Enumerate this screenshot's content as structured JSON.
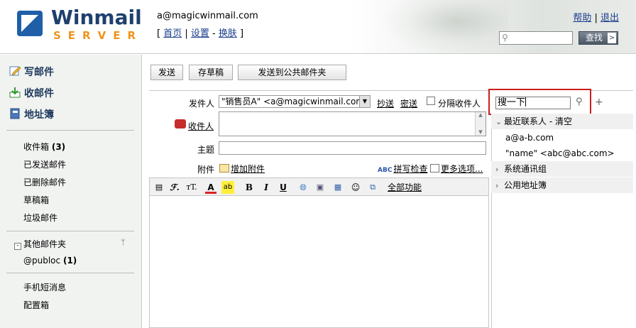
{
  "app": {
    "logo_word1": "Winmail",
    "logo_word2": "SERVER",
    "user_email": "a@magicwinmail.com",
    "top_links": [
      "首页",
      "设置",
      "换肤"
    ],
    "help": "帮助",
    "logout": "退出",
    "search_button": "查找",
    "brand_color": "#1f3f6e",
    "accent_color": "#f0941c"
  },
  "sidebar": {
    "compose": "写邮件",
    "inbox": "收邮件",
    "addressbook": "地址簿",
    "folders": [
      {
        "name": "收件箱",
        "count": "(3)"
      },
      {
        "name": "已发送邮件",
        "count": ""
      },
      {
        "name": "已删除邮件",
        "count": ""
      },
      {
        "name": "草稿箱",
        "count": ""
      },
      {
        "name": "垃圾邮件",
        "count": ""
      }
    ],
    "other_folders": "其他邮件夹",
    "public_folder": {
      "name": "@publoc",
      "count": "(1)"
    },
    "sms": "手机短消息",
    "config": "配置箱"
  },
  "toolbar": {
    "send": "发送",
    "draft": "存草稿",
    "send_public": "发送到公共邮件夹"
  },
  "compose": {
    "from_label": "发件人",
    "from_value": "\"销售员A\" <a@magicwinmail.com>",
    "cc": "抄送",
    "bcc": "密送",
    "separate": "分隔收件人",
    "to_label": "收件人",
    "subject_label": "主题",
    "attach_label": "附件",
    "add_attachment": "增加附件",
    "spell_check": "拼写检查",
    "more_options": "更多选项...",
    "all_features": "全部功能"
  },
  "contacts": {
    "search_value": "搜一下",
    "recent": "最近联系人",
    "clear": "清空",
    "recent_items": [
      "a@a-b.com",
      "\"name\" <abc@abc.com>"
    ],
    "system_groups": "系统通讯组",
    "public_book": "公用地址簿",
    "highlight_color": "#c8201e"
  }
}
